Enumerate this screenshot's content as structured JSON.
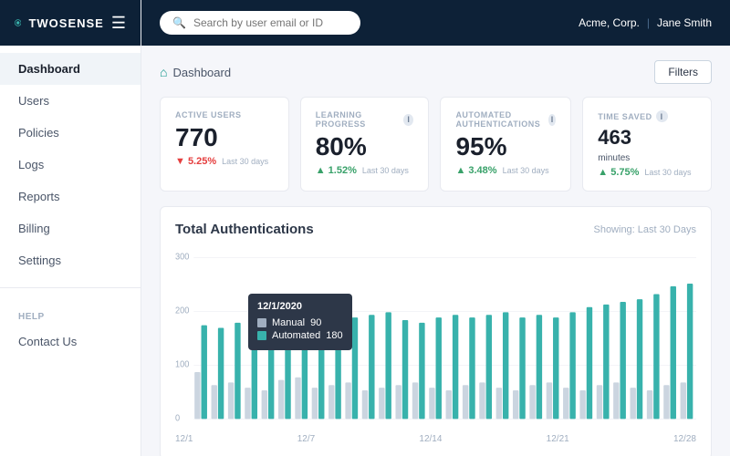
{
  "app": {
    "name": "TWOSENSE"
  },
  "topbar": {
    "search_placeholder": "Search by user email or ID",
    "company": "Acme, Corp.",
    "user": "Jane Smith"
  },
  "sidebar": {
    "nav_items": [
      {
        "label": "Dashboard",
        "active": true,
        "id": "dashboard"
      },
      {
        "label": "Users",
        "active": false,
        "id": "users"
      },
      {
        "label": "Policies",
        "active": false,
        "id": "policies"
      },
      {
        "label": "Logs",
        "active": false,
        "id": "logs"
      },
      {
        "label": "Reports",
        "active": false,
        "id": "reports"
      },
      {
        "label": "Billing",
        "active": false,
        "id": "billing"
      },
      {
        "label": "Settings",
        "active": false,
        "id": "settings"
      }
    ],
    "help_label": "HELP",
    "help_items": [
      {
        "label": "Contact Us",
        "id": "contact-us"
      }
    ]
  },
  "breadcrumb": {
    "label": "Dashboard",
    "filters_label": "Filters"
  },
  "stats": [
    {
      "label": "ACTIVE USERS",
      "value": "770",
      "change": "5.25%",
      "direction": "down",
      "period": "Last 30 days",
      "has_info": false
    },
    {
      "label": "LEARNING PROGRESS",
      "value": "80%",
      "change": "1.52%",
      "direction": "up",
      "period": "Last 30 days",
      "has_info": true
    },
    {
      "label": "AUTOMATED AUTHENTICATIONS",
      "value": "95%",
      "change": "3.48%",
      "direction": "up",
      "period": "Last 30 days",
      "has_info": true
    },
    {
      "label": "TIME SAVED",
      "value": "463",
      "subtext": "minutes",
      "change": "5.75%",
      "direction": "up",
      "period": "Last 30 days",
      "has_info": true
    }
  ],
  "chart": {
    "title": "Total Authentications",
    "showing": "Showing: Last 30 Days",
    "y_labels": [
      "300",
      "200",
      "100",
      "0"
    ],
    "x_labels": [
      "12/1",
      "12/7",
      "12/14",
      "12/21",
      "12/28"
    ],
    "tooltip": {
      "date": "12/1/2020",
      "manual_label": "Manual",
      "manual_value": "90",
      "automated_label": "Automated",
      "automated_value": "180"
    },
    "bars": [
      {
        "manual": 90,
        "automated": 180
      },
      {
        "manual": 65,
        "automated": 175
      },
      {
        "manual": 70,
        "automated": 185
      },
      {
        "manual": 60,
        "automated": 190
      },
      {
        "manual": 55,
        "automated": 195
      },
      {
        "manual": 75,
        "automated": 185
      },
      {
        "manual": 80,
        "automated": 200
      },
      {
        "manual": 60,
        "automated": 195
      },
      {
        "manual": 65,
        "automated": 185
      },
      {
        "manual": 70,
        "automated": 195
      },
      {
        "manual": 55,
        "automated": 200
      },
      {
        "manual": 60,
        "automated": 205
      },
      {
        "manual": 65,
        "automated": 190
      },
      {
        "manual": 70,
        "automated": 185
      },
      {
        "manual": 60,
        "automated": 195
      },
      {
        "manual": 55,
        "automated": 200
      },
      {
        "manual": 65,
        "automated": 195
      },
      {
        "manual": 70,
        "automated": 200
      },
      {
        "manual": 60,
        "automated": 205
      },
      {
        "manual": 55,
        "automated": 195
      },
      {
        "manual": 65,
        "automated": 200
      },
      {
        "manual": 70,
        "automated": 195
      },
      {
        "manual": 60,
        "automated": 205
      },
      {
        "manual": 55,
        "automated": 215
      },
      {
        "manual": 65,
        "automated": 220
      },
      {
        "manual": 70,
        "automated": 225
      },
      {
        "manual": 60,
        "automated": 230
      },
      {
        "manual": 55,
        "automated": 240
      },
      {
        "manual": 65,
        "automated": 255
      },
      {
        "manual": 70,
        "automated": 260
      }
    ]
  }
}
